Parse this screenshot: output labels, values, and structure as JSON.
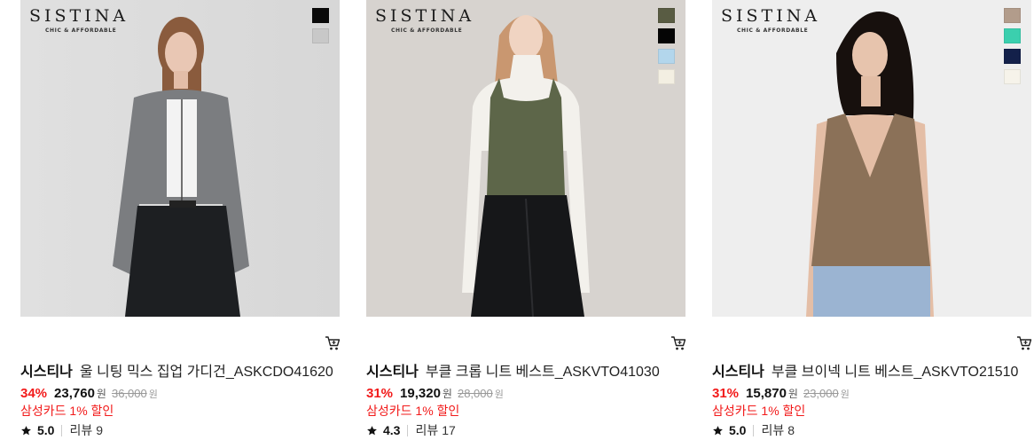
{
  "products": [
    {
      "brand_logo": "SISTINA",
      "brand_tagline": "CHIC & AFFORDABLE",
      "brand": "시스티나",
      "name": "울 니팅 믹스 집업 가디건_ASKCDO41620",
      "discount": "34%",
      "price": "23,760",
      "currency": "원",
      "original_price": "36,000",
      "promo": "삼성카드 1% 할인",
      "rating": "5.0",
      "review_label": "리뷰",
      "review_count": "9",
      "swatches": [
        "#0a0a0a",
        "#c8c8c8"
      ],
      "photo_bg": "#dcdcdc",
      "garment_color": "#7b7d80"
    },
    {
      "brand_logo": "SISTINA",
      "brand_tagline": "CHIC & AFFORDABLE",
      "brand": "시스티나",
      "name": "부클 크롭 니트 베스트_ASKVTO41030",
      "discount": "31%",
      "price": "19,320",
      "currency": "원",
      "original_price": "28,000",
      "promo": "삼성카드 1% 할인",
      "rating": "4.3",
      "review_label": "리뷰",
      "review_count": "17",
      "swatches": [
        "#595c43",
        "#050505",
        "#b3d6ec",
        "#f3efe2"
      ],
      "photo_bg": "#d7d3cf",
      "garment_color": "#5d6649"
    },
    {
      "brand_logo": "SISTINA",
      "brand_tagline": "CHIC & AFFORDABLE",
      "brand": "시스티나",
      "name": "부클 브이넥 니트 베스트_ASKVTO21510",
      "discount": "31%",
      "price": "15,870",
      "currency": "원",
      "original_price": "23,000",
      "promo": "삼성카드 1% 할인",
      "rating": "5.0",
      "review_label": "리뷰",
      "review_count": "8",
      "swatches": [
        "#b29c8b",
        "#3bcfae",
        "#13204a",
        "#f6f3ea"
      ],
      "photo_bg": "#eeeeee",
      "garment_color": "#8b7158"
    }
  ],
  "icons": {
    "cart": "cart-icon",
    "star": "star-icon"
  },
  "colors": {
    "discount": "#f21a1a",
    "promo": "#f21a1a"
  }
}
